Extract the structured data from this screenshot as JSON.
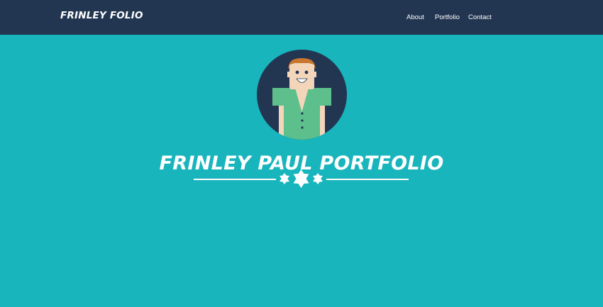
{
  "nav": {
    "brand": "FRINLEY FOLIO",
    "links": [
      "About",
      "Portfolio",
      "Contact"
    ]
  },
  "hero": {
    "title": "FRINLEY PAUL PORTFOLIO",
    "avatar_icon": "avatar-person-icon",
    "divider_icon": "star-divider-icon"
  },
  "colors": {
    "navbar": "#233651",
    "background": "#18b5bd",
    "avatar_circle": "#233651",
    "shirt": "#5dbf8c",
    "skin": "#f3d5ba",
    "hair": "#c9762f",
    "text": "#ffffff"
  }
}
